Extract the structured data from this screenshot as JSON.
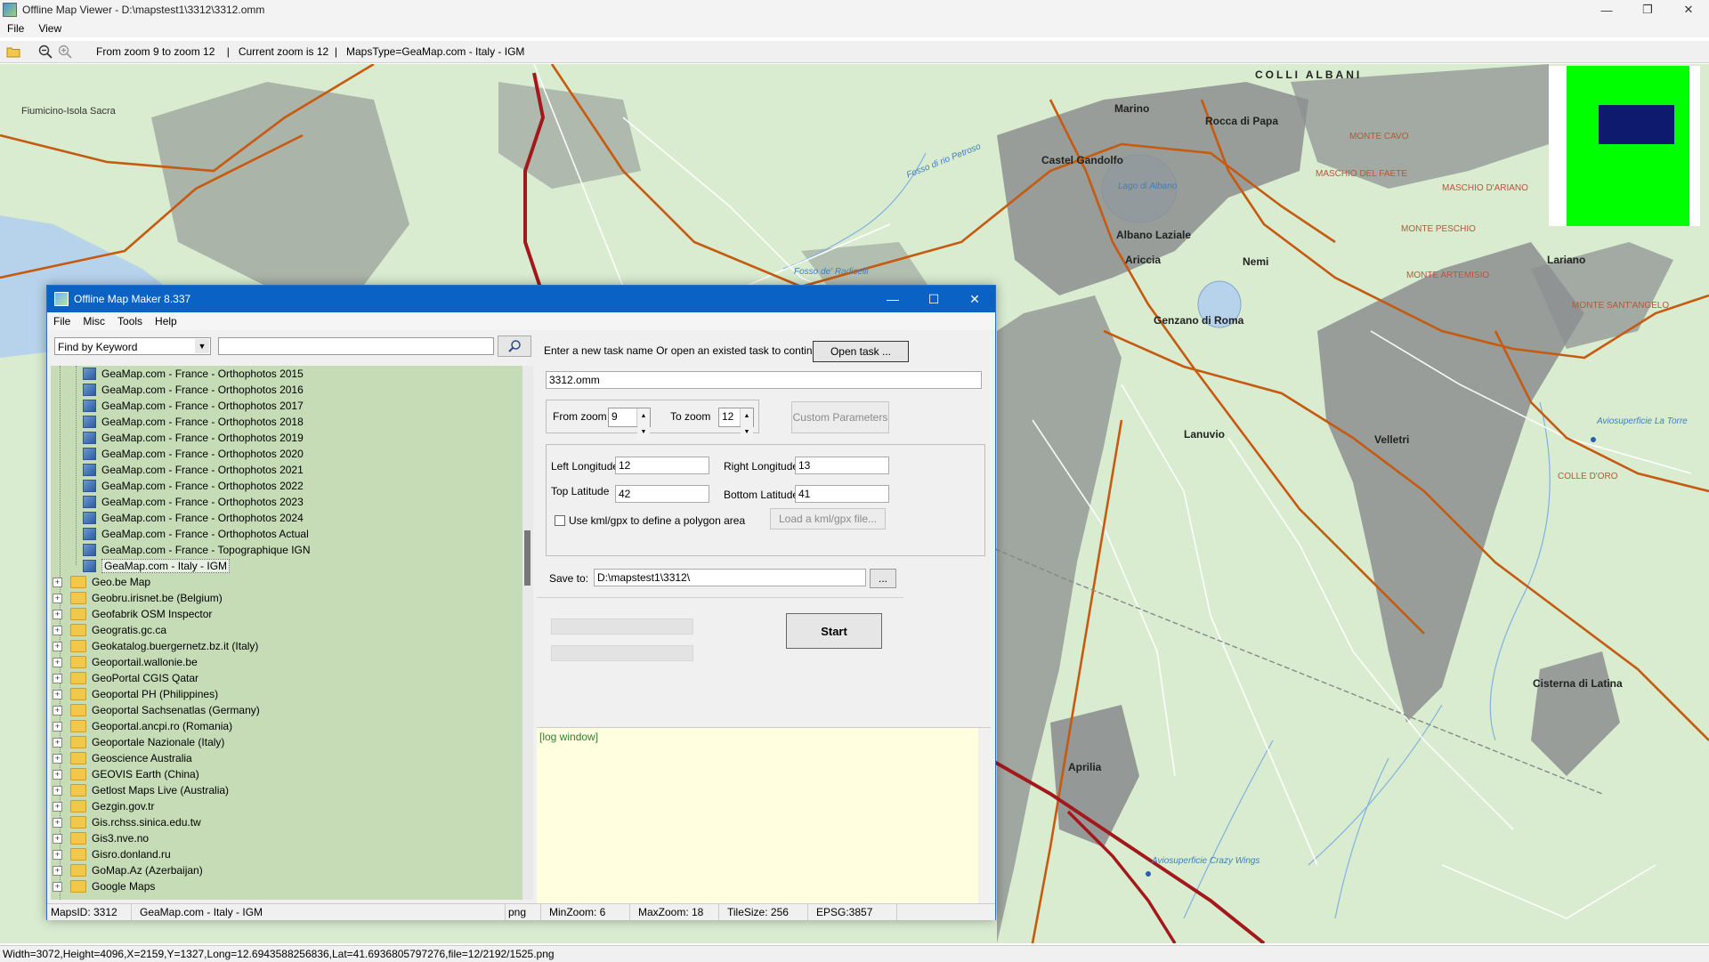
{
  "viewer": {
    "title": "Offline Map Viewer - D:\\mapstest1\\3312\\3312.omm",
    "menu": [
      "File",
      "View"
    ],
    "toolbar_info": "From zoom 9 to zoom 12    |   Current zoom is 12  |   MapsType=GeaMap.com - Italy - IGM",
    "statusbar": "Width=3072,Height=4096,X=2159,Y=1327,Long=12.6943588256836,Lat=41.6936805797276,file=12/2192/1525.png"
  },
  "map_labels": {
    "colli_albani": "COLLI ALBANI",
    "fiumicino": "Fiumicino-Isola Sacra",
    "marino": "Marino",
    "rocca": "Rocca di Papa",
    "castel_gandolfo": "Castel Gandolfo",
    "albano": "Albano Laziale",
    "ariccia": "Ariccia",
    "nemi": "Nemi",
    "genzano": "Genzano di Roma",
    "lanuvio": "Lanuvio",
    "velletri": "Velletri",
    "lariano": "Lariano",
    "aprilia": "Aprilia",
    "cisterna": "Cisterna di Latina",
    "monte_cavo": "MONTE CAVO",
    "monte_peschio": "MONTE PESCHIO",
    "monte_artemisio": "MONTE ARTEMISIO",
    "maschio_faete": "MASCHIO DEL FAETE",
    "maschio_ariano": "MASCHIO D'ARIANO",
    "monte_sant_angelo": "MONTE SANT'ANGELO",
    "colle_doro": "COLLE D'ORO",
    "fosso_radicelli": "Fosso de' Radicelli",
    "fosso_petroso": "Fosso di rio Petroso",
    "avio_torre": "Aviosuperficie La Torre",
    "avio_crazy": "Aviosuperficie Crazy Wings",
    "lago_albano": "Lago di Albano"
  },
  "maker": {
    "title": "Offline Map Maker 8.337",
    "menu": [
      "File",
      "Misc",
      "Tools",
      "Help"
    ],
    "find_mode": "Find by Keyword",
    "search_value": "",
    "tree_items": [
      {
        "label": "GeaMap.com - France - Orthophotos 2015",
        "type": "map"
      },
      {
        "label": "GeaMap.com - France - Orthophotos 2016",
        "type": "map"
      },
      {
        "label": "GeaMap.com - France - Orthophotos 2017",
        "type": "map"
      },
      {
        "label": "GeaMap.com - France - Orthophotos 2018",
        "type": "map"
      },
      {
        "label": "GeaMap.com - France - Orthophotos 2019",
        "type": "map"
      },
      {
        "label": "GeaMap.com - France - Orthophotos 2020",
        "type": "map"
      },
      {
        "label": "GeaMap.com - France - Orthophotos 2021",
        "type": "map"
      },
      {
        "label": "GeaMap.com - France - Orthophotos 2022",
        "type": "map"
      },
      {
        "label": "GeaMap.com - France - Orthophotos 2023",
        "type": "map"
      },
      {
        "label": "GeaMap.com - France - Orthophotos 2024",
        "type": "map"
      },
      {
        "label": "GeaMap.com - France - Orthophotos Actual",
        "type": "map"
      },
      {
        "label": "GeaMap.com - France - Topographique IGN",
        "type": "map"
      },
      {
        "label": "GeaMap.com - Italy - IGM",
        "type": "map",
        "selected": true
      },
      {
        "label": "Geo.be Map",
        "type": "folder"
      },
      {
        "label": "Geobru.irisnet.be (Belgium)",
        "type": "folder"
      },
      {
        "label": "Geofabrik OSM Inspector",
        "type": "folder"
      },
      {
        "label": "Geogratis.gc.ca",
        "type": "folder"
      },
      {
        "label": "Geokatalog.buergernetz.bz.it (Italy)",
        "type": "folder"
      },
      {
        "label": "Geoportail.wallonie.be",
        "type": "folder"
      },
      {
        "label": "GeoPortal CGIS Qatar",
        "type": "folder"
      },
      {
        "label": "Geoportal PH (Philippines)",
        "type": "folder"
      },
      {
        "label": "Geoportal Sachsenatlas (Germany)",
        "type": "folder"
      },
      {
        "label": "Geoportal.ancpi.ro (Romania)",
        "type": "folder"
      },
      {
        "label": "Geoportale Nazionale (Italy)",
        "type": "folder"
      },
      {
        "label": "Geoscience Australia",
        "type": "folder"
      },
      {
        "label": "GEOVIS Earth (China)",
        "type": "folder"
      },
      {
        "label": "Getlost Maps Live (Australia)",
        "type": "folder"
      },
      {
        "label": "Gezgin.gov.tr",
        "type": "folder"
      },
      {
        "label": "Gis.rchss.sinica.edu.tw",
        "type": "folder"
      },
      {
        "label": "Gis3.nve.no",
        "type": "folder"
      },
      {
        "label": "Gisro.donland.ru",
        "type": "folder"
      },
      {
        "label": "GoMap.Az (Azerbaijan)",
        "type": "folder"
      },
      {
        "label": "Google Maps",
        "type": "folder"
      }
    ],
    "task_prompt": "Enter a new task name Or open an existed task to continue:",
    "open_task_label": "Open task ...",
    "task_name": "3312.omm",
    "from_zoom_label": "From zoom",
    "from_zoom": "9",
    "to_zoom_label": "To zoom",
    "to_zoom": "12",
    "custom_params_label": "Custom Parameters",
    "left_lon_label": "Left Longitude",
    "left_lon": "12",
    "right_lon_label": "Right Longitude",
    "right_lon": "13",
    "top_lat_label": "Top Latitude",
    "top_lat": "42",
    "bottom_lat_label": "Bottom Latitude",
    "bottom_lat": "41",
    "kml_label": "Use kml/gpx to define a polygon area",
    "load_kml_label": "Load a kml/gpx file...",
    "save_to_label": "Save to:",
    "save_to": "D:\\mapstest1\\3312\\",
    "browse_label": "...",
    "start_label": "Start",
    "log_text": "[log window]",
    "status": {
      "maps_id": "MapsID: 3312",
      "map_name": "GeaMap.com - Italy - IGM",
      "format": "png",
      "min_zoom": "MinZoom: 6",
      "max_zoom": "MaxZoom: 18",
      "tile_size": "TileSize: 256",
      "epsg": "EPSG:3857"
    }
  },
  "colors": {
    "map_land": "#d9ecd0",
    "map_urban": "#8c8f90",
    "map_water": "#b7d3ec",
    "major_road": "#c65a0f",
    "highway": "#a3191b",
    "maker_titlebar": "#0a62c5",
    "tree_bg": "#c5dcb7",
    "log_bg": "#ffffe0"
  }
}
